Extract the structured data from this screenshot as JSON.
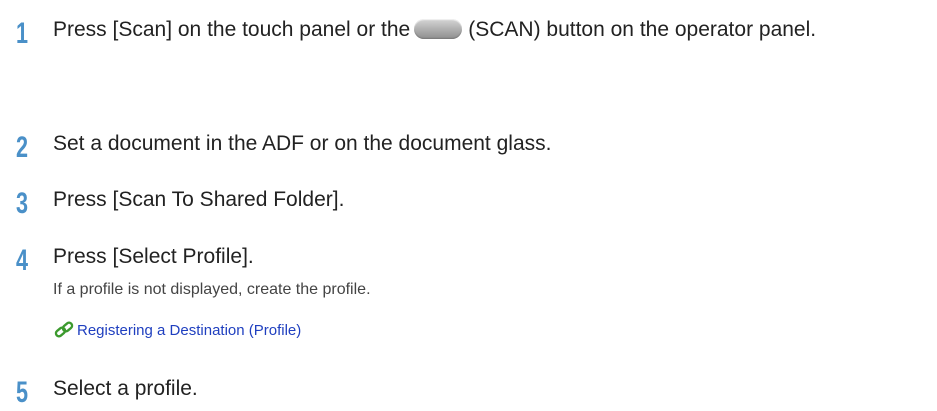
{
  "steps": [
    {
      "number": "1",
      "text_before": "Press [Scan] on the touch panel or the",
      "text_after": "(SCAN) button on the operator panel."
    },
    {
      "number": "2",
      "text": "Set a document in the ADF or on the document glass."
    },
    {
      "number": "3",
      "text": "Press [Scan To Shared Folder]."
    },
    {
      "number": "4",
      "text": "Press [Select Profile].",
      "note": "If a profile is not displayed, create the profile.",
      "link": {
        "icon": "chain-link-icon",
        "label": "Registering a Destination (Profile)"
      }
    },
    {
      "number": "5",
      "text": "Select a profile."
    }
  ],
  "colors": {
    "step_number": "#4a90c8",
    "body_text": "#222222",
    "link_text": "#1f3fbf",
    "link_icon": "#3c9a2e"
  }
}
